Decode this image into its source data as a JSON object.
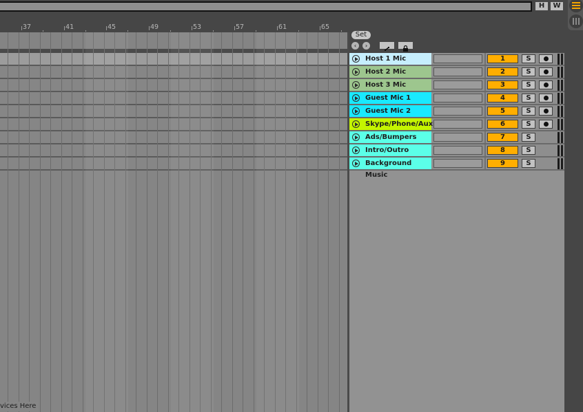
{
  "topbar": {
    "h_button": "H",
    "w_button": "W"
  },
  "ruler": {
    "bars": [
      "37",
      "41",
      "45",
      "49",
      "53",
      "57",
      "61",
      "65"
    ]
  },
  "session": {
    "set_label": "Set",
    "back_icon": "arrow-left-icon",
    "forward_icon": "arrow-right-icon",
    "fold_icon": "fold-icon",
    "lock_icon": "lock-icon"
  },
  "arrangement": {
    "drop_hint": "vices Here"
  },
  "tracks": [
    {
      "name": "Host 1 Mic",
      "number": "1",
      "solo": "S",
      "arm": true,
      "color": "#c6eefd"
    },
    {
      "name": "Host 2 Mic",
      "number": "2",
      "solo": "S",
      "arm": true,
      "color": "#9dc68e"
    },
    {
      "name": "Host 3 Mic",
      "number": "3",
      "solo": "S",
      "arm": true,
      "color": "#9dc68e"
    },
    {
      "name": "Guest Mic 1",
      "number": "4",
      "solo": "S",
      "arm": true,
      "color": "#19e9ff"
    },
    {
      "name": "Guest Mic 2",
      "number": "5",
      "solo": "S",
      "arm": true,
      "color": "#19e9ff"
    },
    {
      "name": "Skype/Phone/Aux",
      "number": "6",
      "solo": "S",
      "arm": true,
      "color": "#c4f500"
    },
    {
      "name": "Ads/Bumpers",
      "number": "7",
      "solo": "S",
      "arm": false,
      "color": "#5bffe8"
    },
    {
      "name": "Intro/Outro Music",
      "number": "8",
      "solo": "S",
      "arm": false,
      "color": "#5bffe8"
    },
    {
      "name": "Background Music",
      "number": "9",
      "solo": "S",
      "arm": false,
      "color": "#5bffe8"
    }
  ],
  "colors": {
    "track_number_active": "#ffae00",
    "accent": "#f5a500"
  }
}
